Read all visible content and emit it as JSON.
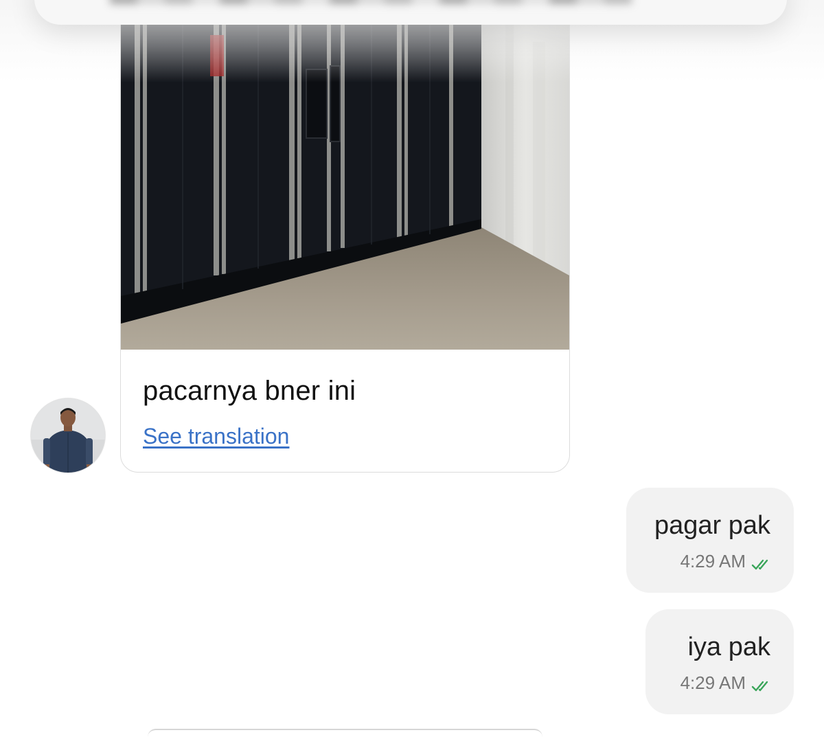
{
  "conversation": {
    "incoming": {
      "caption": "pacarnya bner ini",
      "translate_link": "See translation"
    },
    "outgoing": [
      {
        "text": "pagar pak",
        "time": "4:29 AM",
        "status": "read"
      },
      {
        "text": "iya pak",
        "time": "4:29 AM",
        "status": "read"
      }
    ]
  },
  "colors": {
    "link": "#3a72c7",
    "read_tick": "#3aa55a",
    "outgoing_bubble": "#f2f2f2"
  },
  "icons": {
    "read_receipt": "double-check-icon"
  }
}
